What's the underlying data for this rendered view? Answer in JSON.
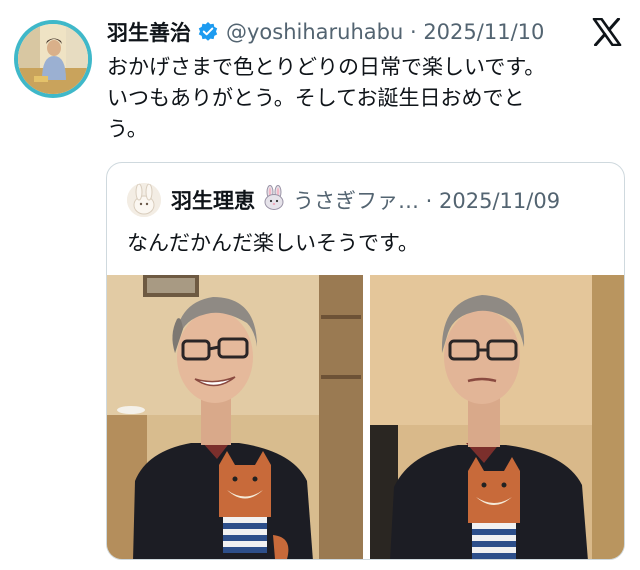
{
  "tweet": {
    "display_name": "羽生善治",
    "handle_date": "@yoshiharuhabu · 2025/11/10",
    "text_lines": [
      "おかげさまで色とりどりの日常で楽しいです。",
      "いつもありがとう。そしてお誕生日おめでと",
      "う。"
    ]
  },
  "quote": {
    "display_name": "羽生理恵",
    "handle_date": "うさぎファ… · 2025/11/09",
    "text": "なんだかんだ楽しいそうです。"
  },
  "colors": {
    "verified": "#1d9bf0",
    "avatar_ring": "#3fb8c9",
    "secondary_text": "#536471"
  }
}
